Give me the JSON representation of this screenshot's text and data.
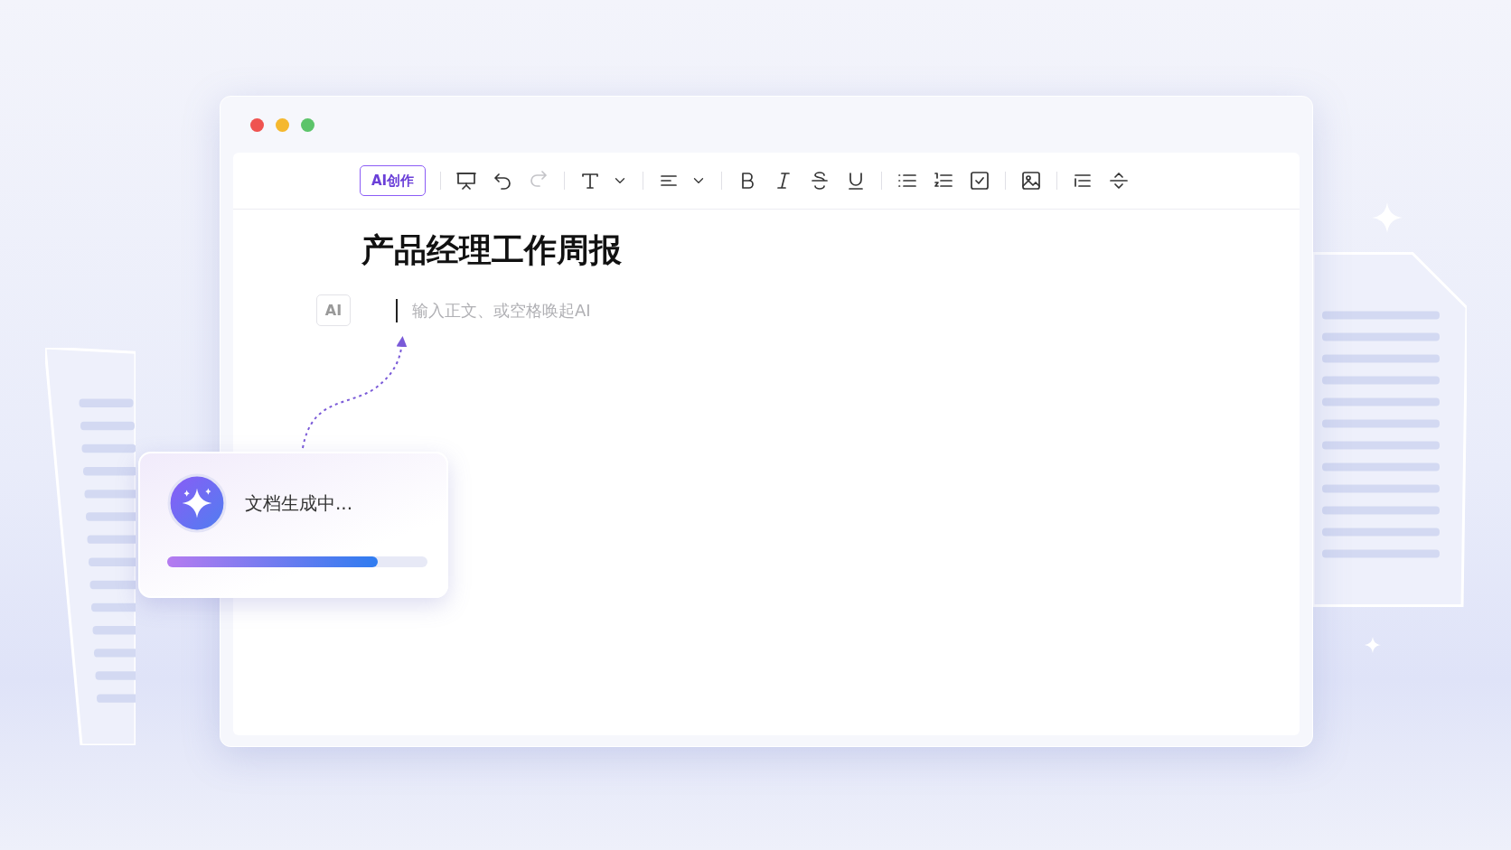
{
  "toolbar": {
    "ai_button": "AI创作",
    "redo": {
      "disabled": true
    }
  },
  "document": {
    "title": "产品经理工作周报",
    "ai_badge": "AI",
    "body": {
      "placeholder": "输入正文、或空格唤起AI"
    }
  },
  "progress_card": {
    "text": "文档生成中...",
    "level": 0.81
  }
}
